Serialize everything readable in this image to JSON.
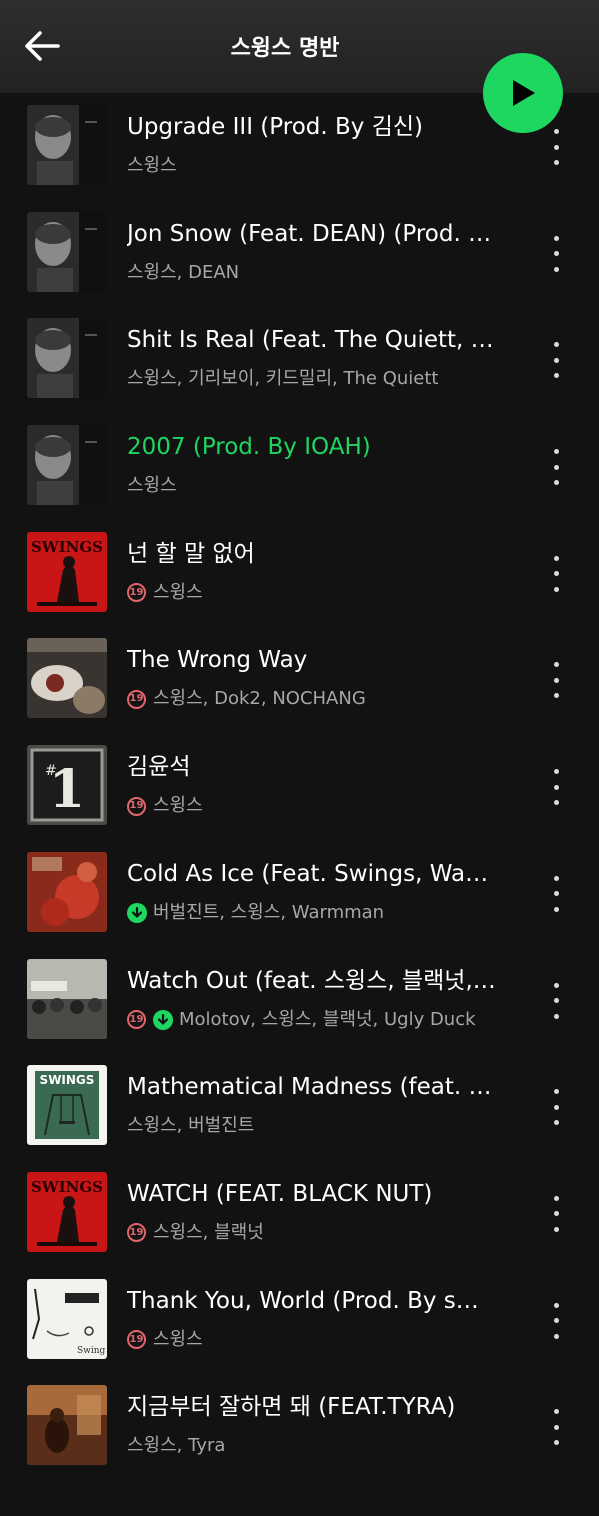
{
  "header": {
    "title": "스윙스 명반",
    "back_icon": "back-arrow-icon",
    "play_icon": "play-icon",
    "accent_color": "#1ed760"
  },
  "tracks": [
    {
      "title": "Upgrade III (Prod. By 김신)",
      "artists": "스윙스",
      "explicit": false,
      "downloaded": false,
      "active": false,
      "cover": "portrait-dark"
    },
    {
      "title": "Jon Snow (Feat. DEAN) (Prod. By 김신)",
      "artists": "스윙스, DEAN",
      "explicit": false,
      "downloaded": false,
      "active": false,
      "cover": "portrait-dark"
    },
    {
      "title": "Shit Is Real (Feat. The Quiett, 기리보이, 키드밀리)",
      "artists": "스윙스, 기리보이, 키드밀리, The Quiett",
      "explicit": false,
      "downloaded": false,
      "active": false,
      "cover": "portrait-dark"
    },
    {
      "title": "2007 (Prod. By IOAH)",
      "artists": "스윙스",
      "explicit": false,
      "downloaded": false,
      "active": true,
      "cover": "portrait-dark"
    },
    {
      "title": "넌 할 말 없어",
      "artists": "스윙스",
      "explicit": true,
      "downloaded": false,
      "active": false,
      "cover": "red-swings"
    },
    {
      "title": "The Wrong Way",
      "artists": "스윙스, Dok2, NOCHANG",
      "explicit": true,
      "downloaded": false,
      "active": false,
      "cover": "hands"
    },
    {
      "title": "김윤석",
      "artists": "스윙스",
      "explicit": true,
      "downloaded": false,
      "active": false,
      "cover": "number-one"
    },
    {
      "title": "Cold As Ice (Feat. Swings, Warmman)",
      "artists": "버벌진트, 스윙스, Warmman",
      "explicit": false,
      "downloaded": true,
      "active": false,
      "cover": "red-flowers"
    },
    {
      "title": "Watch Out (feat. 스윙스, 블랙넛, Ugly Duck)",
      "artists": "Molotov, 스윙스, 블랙넛, Ugly Duck",
      "explicit": true,
      "downloaded": true,
      "active": false,
      "cover": "crowd"
    },
    {
      "title": "Mathematical Madness (feat. 버벌진트)",
      "artists": "스윙스, 버벌진트",
      "explicit": false,
      "downloaded": false,
      "active": false,
      "cover": "swings-swing"
    },
    {
      "title": "WATCH (FEAT. BLACK NUT)",
      "artists": "스윙스, 블랙넛",
      "explicit": true,
      "downloaded": false,
      "active": false,
      "cover": "red-swings"
    },
    {
      "title": "Thank You, World (Prod. By swings)",
      "artists": "스윙스",
      "explicit": true,
      "downloaded": false,
      "active": false,
      "cover": "sketch-white"
    },
    {
      "title": "지금부터 잘하면 돼 (FEAT.TYRA)",
      "artists": "스윙스, Tyra",
      "explicit": false,
      "downloaded": false,
      "active": false,
      "cover": "warm-room"
    }
  ],
  "explicit_badge_label": "19",
  "more_icon": "more-vertical-icon",
  "download_icon": "download-arrow-icon",
  "explicit_color": "#e0666c"
}
